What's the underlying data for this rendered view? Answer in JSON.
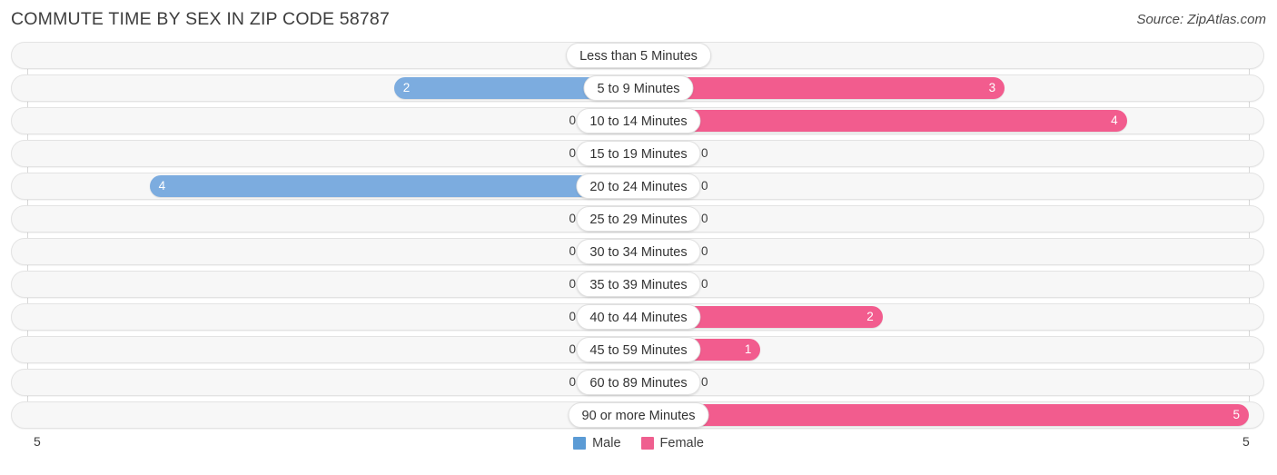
{
  "header": {
    "title": "COMMUTE TIME BY SEX IN ZIP CODE 58787",
    "source": "Source: ZipAtlas.com"
  },
  "legend": {
    "male_label": "Male",
    "female_label": "Female",
    "male_color": "#5b9bd5",
    "female_color": "#ef5f8f"
  },
  "axis": {
    "left_label": "5",
    "right_label": "5",
    "max": 5
  },
  "colors": {
    "male_bar": "#7cacdf",
    "female_bar": "#f25c8e",
    "male_bar_zero": "#aecbe9",
    "female_bar_zero": "#f7a9c4",
    "track": "#f7f7f7",
    "track_border": "#e3e3e3"
  },
  "chart_data": {
    "type": "bar",
    "title": "COMMUTE TIME BY SEX IN ZIP CODE 58787",
    "subtitle": "Source: ZipAtlas.com",
    "orientation": "horizontal-diverging",
    "xlabel": "",
    "ylabel": "",
    "xlim": [
      5,
      5
    ],
    "grid": true,
    "legend_position": "bottom-center",
    "categories": [
      "Less than 5 Minutes",
      "5 to 9 Minutes",
      "10 to 14 Minutes",
      "15 to 19 Minutes",
      "20 to 24 Minutes",
      "25 to 29 Minutes",
      "30 to 34 Minutes",
      "35 to 39 Minutes",
      "40 to 44 Minutes",
      "45 to 59 Minutes",
      "60 to 89 Minutes",
      "90 or more Minutes"
    ],
    "series": [
      {
        "name": "Male",
        "values": [
          0,
          2,
          0,
          0,
          4,
          0,
          0,
          0,
          0,
          0,
          0,
          0
        ]
      },
      {
        "name": "Female",
        "values": [
          0,
          3,
          4,
          0,
          0,
          0,
          0,
          0,
          2,
          1,
          0,
          5
        ]
      }
    ]
  },
  "rows": [
    {
      "label": "Less than 5 Minutes",
      "male": "0",
      "female": "0"
    },
    {
      "label": "5 to 9 Minutes",
      "male": "2",
      "female": "3"
    },
    {
      "label": "10 to 14 Minutes",
      "male": "0",
      "female": "4"
    },
    {
      "label": "15 to 19 Minutes",
      "male": "0",
      "female": "0"
    },
    {
      "label": "20 to 24 Minutes",
      "male": "4",
      "female": "0"
    },
    {
      "label": "25 to 29 Minutes",
      "male": "0",
      "female": "0"
    },
    {
      "label": "30 to 34 Minutes",
      "male": "0",
      "female": "0"
    },
    {
      "label": "35 to 39 Minutes",
      "male": "0",
      "female": "0"
    },
    {
      "label": "40 to 44 Minutes",
      "male": "0",
      "female": "2"
    },
    {
      "label": "45 to 59 Minutes",
      "male": "0",
      "female": "1"
    },
    {
      "label": "60 to 89 Minutes",
      "male": "0",
      "female": "0"
    },
    {
      "label": "90 or more Minutes",
      "male": "0",
      "female": "5"
    }
  ]
}
